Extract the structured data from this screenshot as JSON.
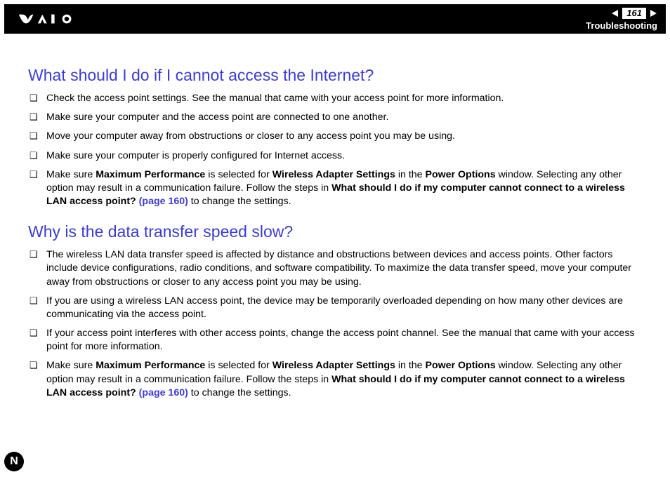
{
  "header": {
    "page_number": "161",
    "section": "Troubleshooting"
  },
  "sections": [
    {
      "heading": "What should I do if I cannot access the Internet?",
      "items": [
        {
          "nodes": [
            {
              "t": "text",
              "v": "Check the access point settings. See the manual that came with your access point for more information."
            }
          ]
        },
        {
          "nodes": [
            {
              "t": "text",
              "v": "Make sure your computer and the access point are connected to one another."
            }
          ]
        },
        {
          "nodes": [
            {
              "t": "text",
              "v": "Move your computer away from obstructions or closer to any access point you may be using."
            }
          ]
        },
        {
          "nodes": [
            {
              "t": "text",
              "v": "Make sure your computer is properly configured for Internet access."
            }
          ]
        },
        {
          "nodes": [
            {
              "t": "text",
              "v": "Make sure "
            },
            {
              "t": "bold",
              "v": "Maximum Performance"
            },
            {
              "t": "text",
              "v": " is selected for "
            },
            {
              "t": "bold",
              "v": "Wireless Adapter Settings"
            },
            {
              "t": "text",
              "v": " in the "
            },
            {
              "t": "bold",
              "v": "Power Options"
            },
            {
              "t": "text",
              "v": " window. Selecting any other option may result in a communication failure. Follow the steps in "
            },
            {
              "t": "bold",
              "v": "What should I do if my computer cannot connect to a wireless LAN access point? "
            },
            {
              "t": "boldlink",
              "v": "(page 160)"
            },
            {
              "t": "text",
              "v": " to change the settings."
            }
          ]
        }
      ]
    },
    {
      "heading": "Why is the data transfer speed slow?",
      "items": [
        {
          "nodes": [
            {
              "t": "text",
              "v": "The wireless LAN data transfer speed is affected by distance and obstructions between devices and access points. Other factors include device configurations, radio conditions, and software compatibility. To maximize the data transfer speed, move your computer away from obstructions or closer to any access point you may be using."
            }
          ]
        },
        {
          "nodes": [
            {
              "t": "text",
              "v": "If you are using a wireless LAN access point, the device may be temporarily overloaded depending on how many other devices are communicating via the access point."
            }
          ]
        },
        {
          "nodes": [
            {
              "t": "text",
              "v": "If your access point interferes with other access points, change the access point channel. See the manual that came with your access point for more information."
            }
          ]
        },
        {
          "nodes": [
            {
              "t": "text",
              "v": "Make sure "
            },
            {
              "t": "bold",
              "v": "Maximum Performance"
            },
            {
              "t": "text",
              "v": " is selected for "
            },
            {
              "t": "bold",
              "v": "Wireless Adapter Settings"
            },
            {
              "t": "text",
              "v": " in the "
            },
            {
              "t": "bold",
              "v": "Power Options"
            },
            {
              "t": "text",
              "v": " window. Selecting any other option may result in a communication failure. Follow the steps in "
            },
            {
              "t": "bold",
              "v": "What should I do if my computer cannot connect to a wireless LAN access point? "
            },
            {
              "t": "boldlink",
              "v": "(page 160)"
            },
            {
              "t": "text",
              "v": " to change the settings."
            }
          ]
        }
      ]
    }
  ],
  "footer_marker": "N"
}
